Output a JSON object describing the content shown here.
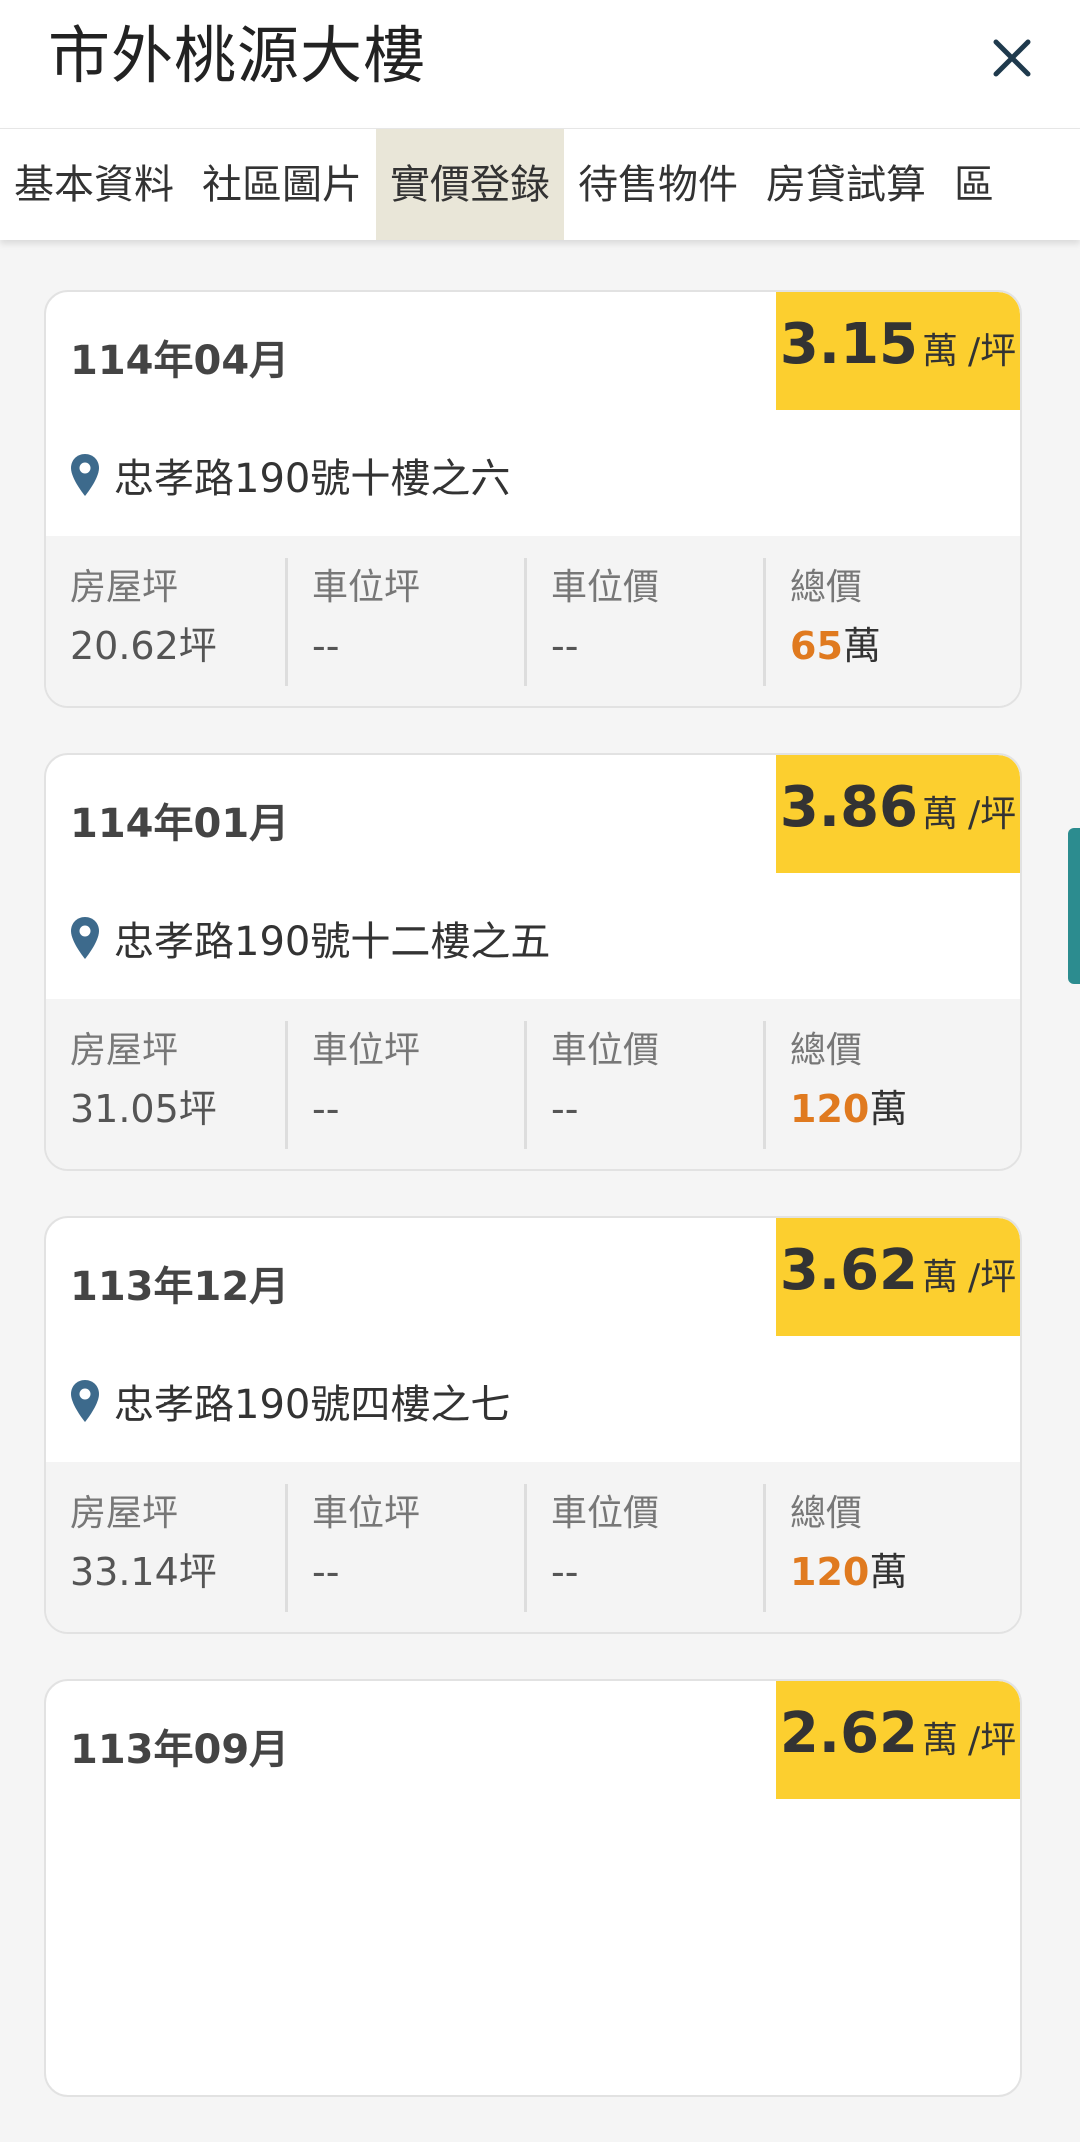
{
  "header": {
    "title": "市外桃源大樓"
  },
  "tabs": [
    {
      "label": "基本資料",
      "active": false
    },
    {
      "label": "社區圖片",
      "active": false
    },
    {
      "label": "實價登錄",
      "active": true
    },
    {
      "label": "待售物件",
      "active": false
    },
    {
      "label": "房貸試算",
      "active": false
    },
    {
      "label": "區",
      "active": false
    }
  ],
  "labels": {
    "house_area": "房屋坪",
    "parking_area": "車位坪",
    "parking_price": "車位價",
    "total_price": "總價",
    "wan": "萬",
    "per_ping": "/坪",
    "ping_unit": "坪"
  },
  "colors": {
    "badge": "#fccf2f",
    "total_price": "#e07a1f",
    "active_tab": "#e9e6d8",
    "pin": "#3d6a8c"
  },
  "records": [
    {
      "date": "114年04月",
      "unit_price": "3.15",
      "address": "忠孝路190號十樓之六",
      "house_area": "20.62坪",
      "parking_area": "--",
      "parking_price": "--",
      "total": "65"
    },
    {
      "date": "114年01月",
      "unit_price": "3.86",
      "address": "忠孝路190號十二樓之五",
      "house_area": "31.05坪",
      "parking_area": "--",
      "parking_price": "--",
      "total": "120"
    },
    {
      "date": "113年12月",
      "unit_price": "3.62",
      "address": "忠孝路190號四樓之七",
      "house_area": "33.14坪",
      "parking_area": "--",
      "parking_price": "--",
      "total": "120"
    },
    {
      "date": "113年09月",
      "unit_price": "2.62"
    }
  ]
}
